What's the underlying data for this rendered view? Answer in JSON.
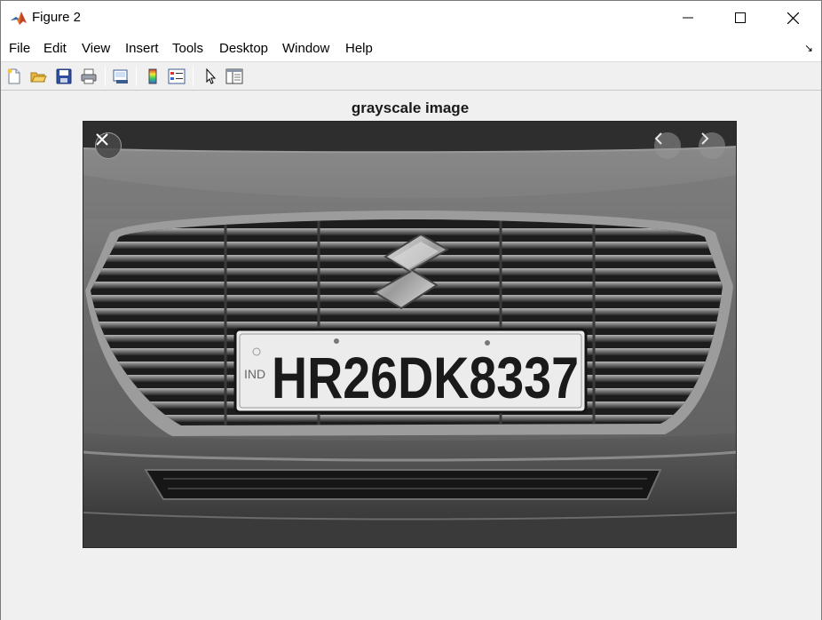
{
  "window": {
    "title": "Figure 2"
  },
  "menu": {
    "items": [
      "File",
      "Edit",
      "View",
      "Insert",
      "Tools",
      "Desktop",
      "Window",
      "Help"
    ]
  },
  "toolbar": {
    "buttons": [
      "new-figure-icon",
      "open-file-icon",
      "save-icon",
      "print-icon",
      "link-plot-icon",
      "colorbar-icon",
      "legend-icon",
      "pointer-icon",
      "property-inspector-icon"
    ]
  },
  "figure": {
    "title": "grayscale image"
  },
  "image": {
    "plate_country": "IND",
    "plate_number": "HR26DK8337"
  },
  "colors": {
    "titlebar_bg": "#ffffff",
    "figure_bg": "#f0f0f0",
    "plate_text": "#1a1a1a"
  }
}
